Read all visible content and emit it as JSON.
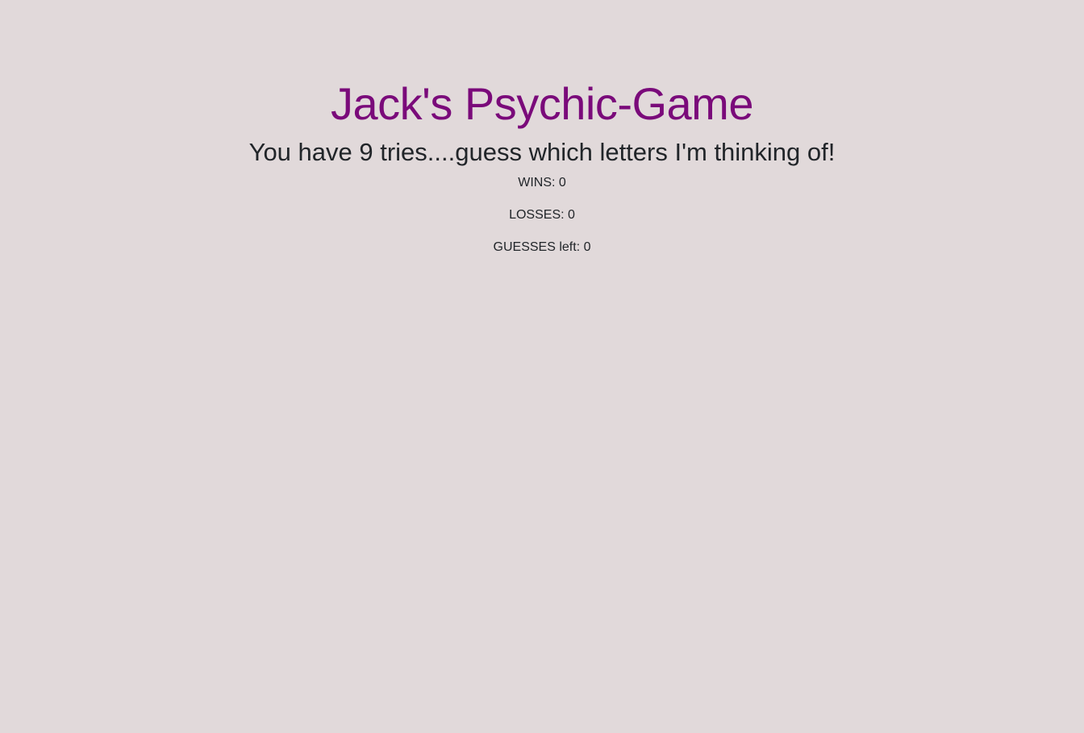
{
  "header": {
    "title": "Jack's Psychic-Game",
    "subtitle": "You have 9 tries....guess which letters I'm thinking of!"
  },
  "stats": {
    "wins": "WINS: 0",
    "losses": "LOSSES: 0",
    "guesses_left": "GUESSES left: 0"
  },
  "colors": {
    "background": "#e1d9da",
    "title": "#7a0a7a",
    "text": "#212529"
  }
}
